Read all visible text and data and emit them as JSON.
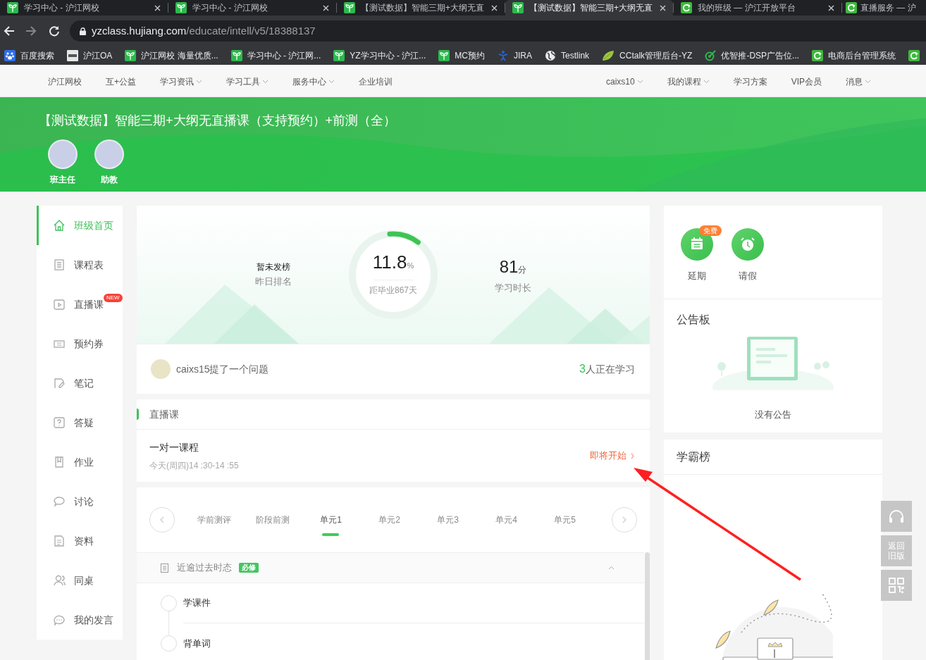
{
  "browser": {
    "tabs": [
      {
        "title": "学习中心 - 沪江网校",
        "selected": false
      },
      {
        "title": "学习中心 - 沪江网校",
        "selected": false
      },
      {
        "title": "【测试数据】智能三期+大纲无直",
        "selected": false
      },
      {
        "title": "【测试数据】智能三期+大纲无直",
        "selected": true
      },
      {
        "title": "我的班级 — 沪江开放平台",
        "selected": false
      },
      {
        "title": "直播服务 — 沪",
        "selected": false
      }
    ],
    "url": {
      "host": "yzclass.hujiang.com",
      "path": "/educate/intell/v5/18388137"
    },
    "bookmarks": [
      "百度搜索",
      "沪江OA",
      "沪江网校 海量优质...",
      "学习中心 - 沪江网...",
      "YZ学习中心 - 沪江...",
      "MC预约",
      "JIRA",
      "Testlink",
      "CCtalk管理后台-YZ",
      "优智推-DSP广告位...",
      "电商后台管理系统"
    ]
  },
  "nav": {
    "left": [
      {
        "label": "沪江网校",
        "dropdown": false
      },
      {
        "label": "互+公益",
        "dropdown": false
      },
      {
        "label": "学习资讯",
        "dropdown": true
      },
      {
        "label": "学习工具",
        "dropdown": true
      },
      {
        "label": "服务中心",
        "dropdown": true
      },
      {
        "label": "企业培训",
        "dropdown": false
      }
    ],
    "right": [
      {
        "label": "caixs10",
        "dropdown": true
      },
      {
        "label": "我的课程",
        "dropdown": true
      },
      {
        "label": "学习方案",
        "dropdown": false
      },
      {
        "label": "VIP会员",
        "dropdown": false
      },
      {
        "label": "消息",
        "dropdown": true
      }
    ]
  },
  "banner": {
    "title": "【测试数据】智能三期+大纲无直播课（支持预约）+前测（全）",
    "staff": [
      "班主任",
      "助教"
    ]
  },
  "sidebar": {
    "items": [
      {
        "label": "班级首页",
        "selected": true
      },
      {
        "label": "课程表",
        "selected": false
      },
      {
        "label": "直播课",
        "selected": false,
        "badge": "NEW"
      },
      {
        "label": "预约券",
        "selected": false
      },
      {
        "label": "笔记",
        "selected": false
      },
      {
        "label": "答疑",
        "selected": false
      },
      {
        "label": "作业",
        "selected": false
      },
      {
        "label": "讨论",
        "selected": false
      },
      {
        "label": "资料",
        "selected": false
      },
      {
        "label": "同桌",
        "selected": false
      },
      {
        "label": "我的发言",
        "selected": false
      }
    ]
  },
  "stats": {
    "rank": {
      "value": "暂未发榜",
      "label": "昨日排名"
    },
    "progress": {
      "value": "11.8",
      "unit": "%",
      "level": 0.118,
      "caption": "距毕业867天"
    },
    "study_time": {
      "value": "81",
      "unit": "分",
      "label": "学习时长"
    }
  },
  "activity": {
    "text": "caixs15提了一个问题",
    "learners_count": "3",
    "learners_text": "人正在学习"
  },
  "live": {
    "title": "直播课",
    "items": [
      {
        "title": "一对一课程",
        "time": "今天(周四)14 :30-14 :55",
        "status": "即将开始"
      }
    ]
  },
  "units": {
    "tabs": [
      {
        "label": "学前测评",
        "selected": false
      },
      {
        "label": "阶段前测",
        "selected": false
      },
      {
        "label": "单元1",
        "selected": true
      },
      {
        "label": "单元2",
        "selected": false
      },
      {
        "label": "单元3",
        "selected": false
      },
      {
        "label": "单元4",
        "selected": false
      },
      {
        "label": "单元5",
        "selected": false
      }
    ],
    "section": {
      "title": "近逾过去时态",
      "badge": "必修",
      "expanded": true,
      "tasks": [
        "学课件",
        "背单词"
      ]
    }
  },
  "side_actions": [
    {
      "label": "延期",
      "badge": "免费"
    },
    {
      "label": "请假"
    }
  ],
  "notice_board": {
    "title": "公告板",
    "empty_text": "没有公告"
  },
  "leaderboard": {
    "title": "学霸榜"
  },
  "float_buttons": {
    "old_version": "返回旧版"
  }
}
